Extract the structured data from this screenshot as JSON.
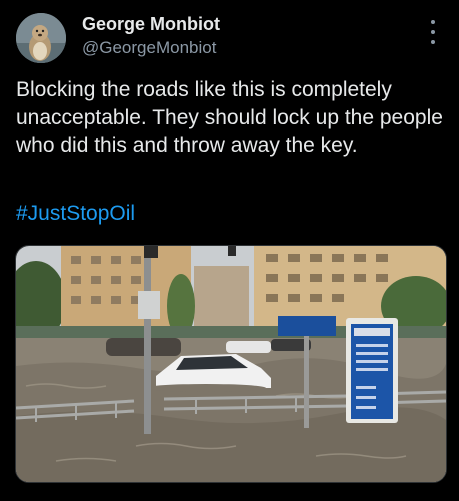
{
  "author": {
    "display_name": "George Monbiot",
    "handle": "@GeorgeMonbiot",
    "avatar_icon": "otter-avatar"
  },
  "tweet": {
    "text": "Blocking the roads like this is completely unacceptable. They should lock up the people who did this and throw away the key.",
    "hashtag": "#JustStopOil"
  },
  "menu": {
    "icon": "more-vertical-icon"
  },
  "media": {
    "description_icon": "flooded-street-photo",
    "sign_text_top": "",
    "sign_text_lines": []
  },
  "colors": {
    "background": "#000000",
    "text": "#e7e9ea",
    "secondary": "#8b98a5",
    "link": "#1d9bf0"
  }
}
